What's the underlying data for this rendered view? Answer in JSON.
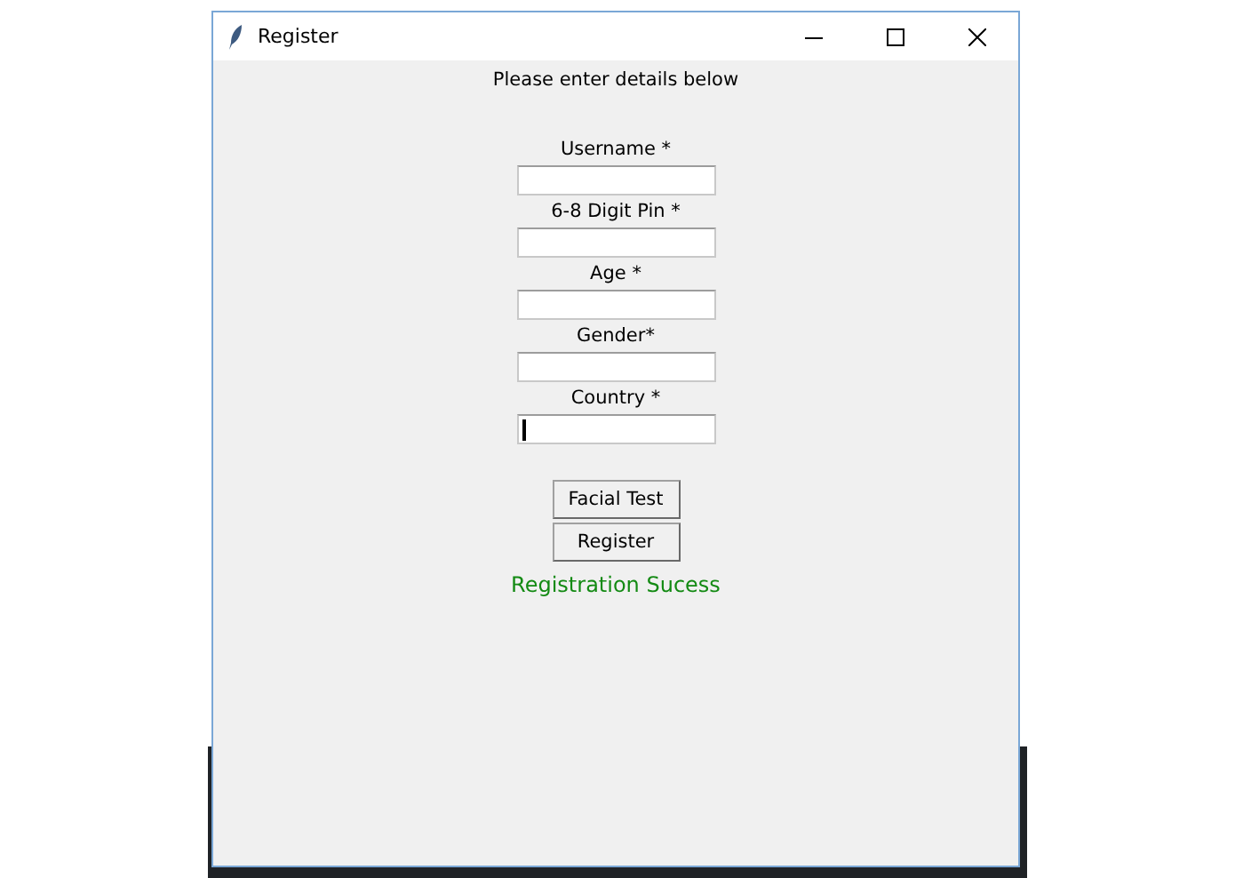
{
  "window": {
    "title": "Register"
  },
  "heading": "Please enter details below",
  "fields": [
    {
      "label": "Username *",
      "focused": false
    },
    {
      "label": "6-8 Digit Pin *",
      "focused": false
    },
    {
      "label": "Age *",
      "focused": false
    },
    {
      "label": "Gender*",
      "focused": false
    },
    {
      "label": "Country *",
      "focused": true
    }
  ],
  "buttons": [
    "Facial Test",
    "Register"
  ],
  "status": {
    "text": "Registration Sucess",
    "color": "#138a13"
  }
}
